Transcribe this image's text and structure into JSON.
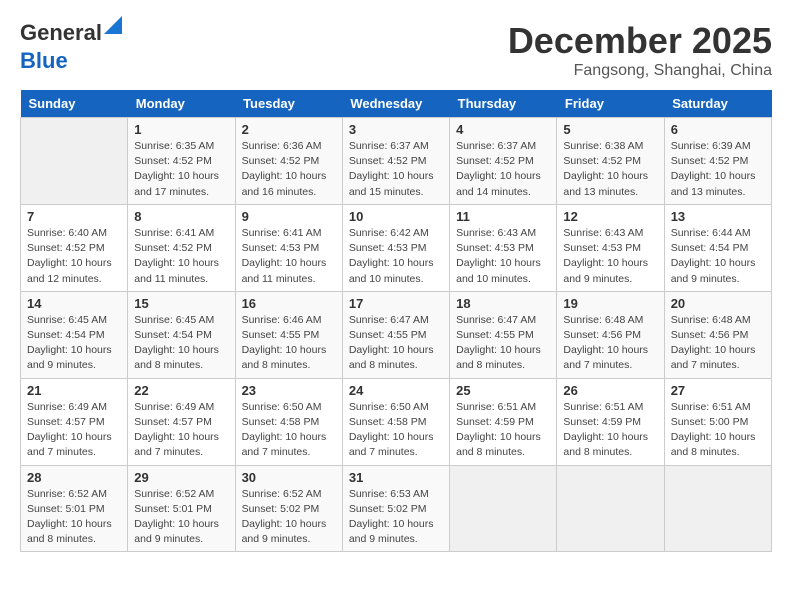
{
  "header": {
    "logo_line1": "General",
    "logo_line2": "Blue",
    "month": "December 2025",
    "location": "Fangsong, Shanghai, China"
  },
  "weekdays": [
    "Sunday",
    "Monday",
    "Tuesday",
    "Wednesday",
    "Thursday",
    "Friday",
    "Saturday"
  ],
  "weeks": [
    [
      {
        "day": "",
        "info": ""
      },
      {
        "day": "1",
        "info": "Sunrise: 6:35 AM\nSunset: 4:52 PM\nDaylight: 10 hours\nand 17 minutes."
      },
      {
        "day": "2",
        "info": "Sunrise: 6:36 AM\nSunset: 4:52 PM\nDaylight: 10 hours\nand 16 minutes."
      },
      {
        "day": "3",
        "info": "Sunrise: 6:37 AM\nSunset: 4:52 PM\nDaylight: 10 hours\nand 15 minutes."
      },
      {
        "day": "4",
        "info": "Sunrise: 6:37 AM\nSunset: 4:52 PM\nDaylight: 10 hours\nand 14 minutes."
      },
      {
        "day": "5",
        "info": "Sunrise: 6:38 AM\nSunset: 4:52 PM\nDaylight: 10 hours\nand 13 minutes."
      },
      {
        "day": "6",
        "info": "Sunrise: 6:39 AM\nSunset: 4:52 PM\nDaylight: 10 hours\nand 13 minutes."
      }
    ],
    [
      {
        "day": "7",
        "info": "Sunrise: 6:40 AM\nSunset: 4:52 PM\nDaylight: 10 hours\nand 12 minutes."
      },
      {
        "day": "8",
        "info": "Sunrise: 6:41 AM\nSunset: 4:52 PM\nDaylight: 10 hours\nand 11 minutes."
      },
      {
        "day": "9",
        "info": "Sunrise: 6:41 AM\nSunset: 4:53 PM\nDaylight: 10 hours\nand 11 minutes."
      },
      {
        "day": "10",
        "info": "Sunrise: 6:42 AM\nSunset: 4:53 PM\nDaylight: 10 hours\nand 10 minutes."
      },
      {
        "day": "11",
        "info": "Sunrise: 6:43 AM\nSunset: 4:53 PM\nDaylight: 10 hours\nand 10 minutes."
      },
      {
        "day": "12",
        "info": "Sunrise: 6:43 AM\nSunset: 4:53 PM\nDaylight: 10 hours\nand 9 minutes."
      },
      {
        "day": "13",
        "info": "Sunrise: 6:44 AM\nSunset: 4:54 PM\nDaylight: 10 hours\nand 9 minutes."
      }
    ],
    [
      {
        "day": "14",
        "info": "Sunrise: 6:45 AM\nSunset: 4:54 PM\nDaylight: 10 hours\nand 9 minutes."
      },
      {
        "day": "15",
        "info": "Sunrise: 6:45 AM\nSunset: 4:54 PM\nDaylight: 10 hours\nand 8 minutes."
      },
      {
        "day": "16",
        "info": "Sunrise: 6:46 AM\nSunset: 4:55 PM\nDaylight: 10 hours\nand 8 minutes."
      },
      {
        "day": "17",
        "info": "Sunrise: 6:47 AM\nSunset: 4:55 PM\nDaylight: 10 hours\nand 8 minutes."
      },
      {
        "day": "18",
        "info": "Sunrise: 6:47 AM\nSunset: 4:55 PM\nDaylight: 10 hours\nand 8 minutes."
      },
      {
        "day": "19",
        "info": "Sunrise: 6:48 AM\nSunset: 4:56 PM\nDaylight: 10 hours\nand 7 minutes."
      },
      {
        "day": "20",
        "info": "Sunrise: 6:48 AM\nSunset: 4:56 PM\nDaylight: 10 hours\nand 7 minutes."
      }
    ],
    [
      {
        "day": "21",
        "info": "Sunrise: 6:49 AM\nSunset: 4:57 PM\nDaylight: 10 hours\nand 7 minutes."
      },
      {
        "day": "22",
        "info": "Sunrise: 6:49 AM\nSunset: 4:57 PM\nDaylight: 10 hours\nand 7 minutes."
      },
      {
        "day": "23",
        "info": "Sunrise: 6:50 AM\nSunset: 4:58 PM\nDaylight: 10 hours\nand 7 minutes."
      },
      {
        "day": "24",
        "info": "Sunrise: 6:50 AM\nSunset: 4:58 PM\nDaylight: 10 hours\nand 7 minutes."
      },
      {
        "day": "25",
        "info": "Sunrise: 6:51 AM\nSunset: 4:59 PM\nDaylight: 10 hours\nand 8 minutes."
      },
      {
        "day": "26",
        "info": "Sunrise: 6:51 AM\nSunset: 4:59 PM\nDaylight: 10 hours\nand 8 minutes."
      },
      {
        "day": "27",
        "info": "Sunrise: 6:51 AM\nSunset: 5:00 PM\nDaylight: 10 hours\nand 8 minutes."
      }
    ],
    [
      {
        "day": "28",
        "info": "Sunrise: 6:52 AM\nSunset: 5:01 PM\nDaylight: 10 hours\nand 8 minutes."
      },
      {
        "day": "29",
        "info": "Sunrise: 6:52 AM\nSunset: 5:01 PM\nDaylight: 10 hours\nand 9 minutes."
      },
      {
        "day": "30",
        "info": "Sunrise: 6:52 AM\nSunset: 5:02 PM\nDaylight: 10 hours\nand 9 minutes."
      },
      {
        "day": "31",
        "info": "Sunrise: 6:53 AM\nSunset: 5:02 PM\nDaylight: 10 hours\nand 9 minutes."
      },
      {
        "day": "",
        "info": ""
      },
      {
        "day": "",
        "info": ""
      },
      {
        "day": "",
        "info": ""
      }
    ]
  ]
}
